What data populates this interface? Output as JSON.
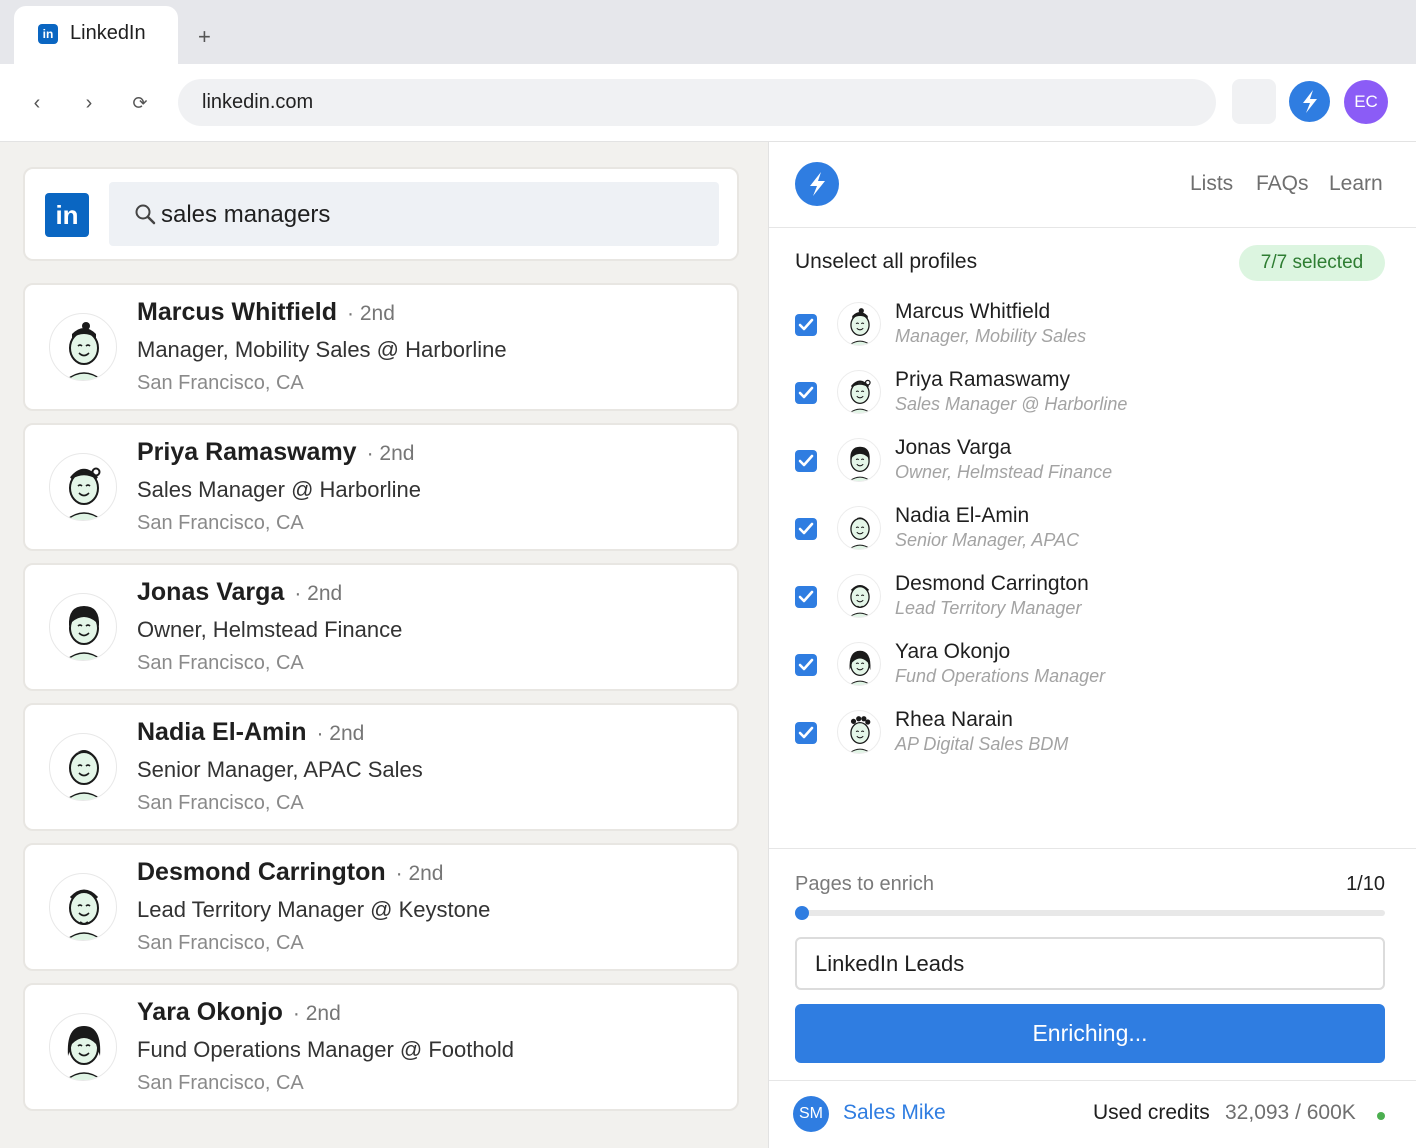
{
  "browser": {
    "tab_title": "LinkedIn",
    "tab_favicon": "in",
    "new_tab_label": "+",
    "back_label": "‹",
    "forward_label": "›",
    "reload_label": "⟳",
    "url": "linkedin.com",
    "profile_initials": "EC",
    "profile_color": "#8b5cf6"
  },
  "linkedin": {
    "logo_text": "in",
    "search_query": "sales managers",
    "results": [
      {
        "name": "Marcus Whitfield",
        "degree": "· 2nd",
        "title": "Manager, Mobility Sales @ Harborline",
        "location": "San Francisco, CA"
      },
      {
        "name": "Priya Ramaswamy",
        "degree": "· 2nd",
        "title": "Sales Manager @ Harborline",
        "location": "San Francisco, CA"
      },
      {
        "name": "Jonas Varga",
        "degree": "· 2nd",
        "title": "Owner, Helmstead Finance",
        "location": "San Francisco, CA"
      },
      {
        "name": "Nadia El-Amin",
        "degree": "· 2nd",
        "title": "Senior Manager, APAC Sales",
        "location": "San Francisco, CA"
      },
      {
        "name": "Desmond Carrington",
        "degree": "· 2nd",
        "title": "Lead Territory Manager @ Keystone",
        "location": "San Francisco, CA"
      },
      {
        "name": "Yara Okonjo",
        "degree": "· 2nd",
        "title": "Fund Operations Manager @ Foothold",
        "location": "San Francisco, CA"
      }
    ]
  },
  "extension": {
    "nav": {
      "lists": "Lists",
      "faqs": "FAQs",
      "learn": "Learn"
    },
    "unselect_label": "Unselect all profiles",
    "selected_badge": "7/7 selected",
    "selected_profiles": [
      {
        "name": "Marcus Whitfield",
        "subtitle": "Manager, Mobility Sales",
        "checked": true
      },
      {
        "name": "Priya Ramaswamy",
        "subtitle": "Sales Manager @ Harborline",
        "checked": true
      },
      {
        "name": "Jonas Varga",
        "subtitle": "Owner, Helmstead Finance",
        "checked": true
      },
      {
        "name": "Nadia El-Amin",
        "subtitle": "Senior Manager, APAC",
        "checked": true
      },
      {
        "name": "Desmond Carrington",
        "subtitle": "Lead Territory Manager",
        "checked": true
      },
      {
        "name": "Yara Okonjo",
        "subtitle": "Fund Operations Manager",
        "checked": true
      },
      {
        "name": "Rhea Narain",
        "subtitle": "AP Digital Sales BDM",
        "checked": true
      }
    ],
    "pages_label": "Pages to enrich",
    "pages_value": "1/10",
    "pages_fraction": 0.0,
    "list_name_value": "LinkedIn Leads",
    "enrich_button_label": "Enriching...",
    "footer": {
      "user_initials": "SM",
      "user_name": "Sales Mike",
      "credits_label": "Used credits",
      "credits_value": "32,093 / 600K",
      "status_color": "#4caf50"
    },
    "accent_color": "#2f7de1"
  }
}
